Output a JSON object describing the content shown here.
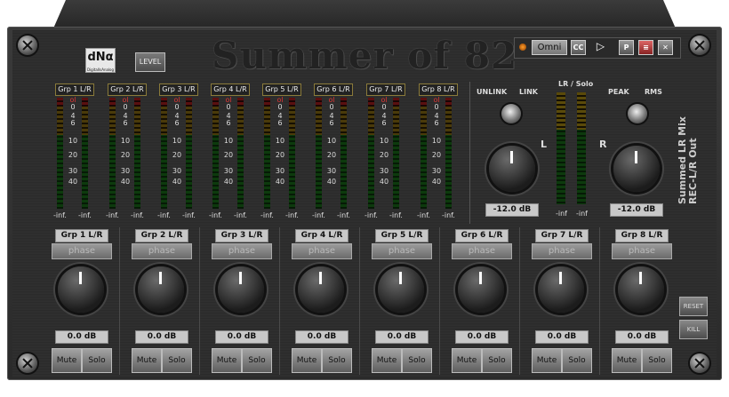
{
  "app": {
    "logo_text": "dNα",
    "logo_sub": "DigitalIsAnalog",
    "level_button": "LEVEL",
    "title": "Summer of 82"
  },
  "topbar": {
    "preset": "Omni",
    "cc": "CC",
    "p": "P"
  },
  "meters": {
    "groups": [
      "Grp 1 L/R",
      "Grp 2 L/R",
      "Grp 3 L/R",
      "Grp 4 L/R",
      "Grp 5 L/R",
      "Grp 6 L/R",
      "Grp 7 L/R",
      "Grp 8 L/R"
    ],
    "scale": [
      "ol",
      "0",
      "4",
      "6",
      "10",
      "20",
      "30",
      "40"
    ],
    "inf_label": "-inf."
  },
  "master": {
    "unlink": "UNLINK",
    "link": "LINK",
    "lr_solo": "LR / Solo",
    "peak": "PEAK",
    "rms": "RMS",
    "l": "L",
    "r": "R",
    "left_db": "-12.0 dB",
    "right_db": "-12.0 dB",
    "inf_l": "-inf",
    "inf_r": "-inf",
    "vertical_title": "Summed LR Mix",
    "vertical_sub": "REC-L/R Out"
  },
  "strips": [
    {
      "name": "Grp 1 L/R",
      "phase": "phase",
      "gain": "0.0 dB",
      "mute": "Mute",
      "solo": "Solo"
    },
    {
      "name": "Grp 2 L/R",
      "phase": "phase",
      "gain": "0.0 dB",
      "mute": "Mute",
      "solo": "Solo"
    },
    {
      "name": "Grp 3 L/R",
      "phase": "phase",
      "gain": "0.0 dB",
      "mute": "Mute",
      "solo": "Solo"
    },
    {
      "name": "Grp 4 L/R",
      "phase": "phase",
      "gain": "0.0 dB",
      "mute": "Mute",
      "solo": "Solo"
    },
    {
      "name": "Grp 5 L/R",
      "phase": "phase",
      "gain": "0.0 dB",
      "mute": "Mute",
      "solo": "Solo"
    },
    {
      "name": "Grp 6 L/R",
      "phase": "phase",
      "gain": "0.0 dB",
      "mute": "Mute",
      "solo": "Solo"
    },
    {
      "name": "Grp 7 L/R",
      "phase": "phase",
      "gain": "0.0 dB",
      "mute": "Mute",
      "solo": "Solo"
    },
    {
      "name": "Grp 8 L/R",
      "phase": "phase",
      "gain": "0.0 dB",
      "mute": "Mute",
      "solo": "Solo"
    }
  ],
  "side": {
    "reset": "RESET",
    "kill": "KILL"
  },
  "icons": {
    "speaker": "speaker-icon",
    "minimize": "minimize-icon",
    "close": "close-icon"
  }
}
